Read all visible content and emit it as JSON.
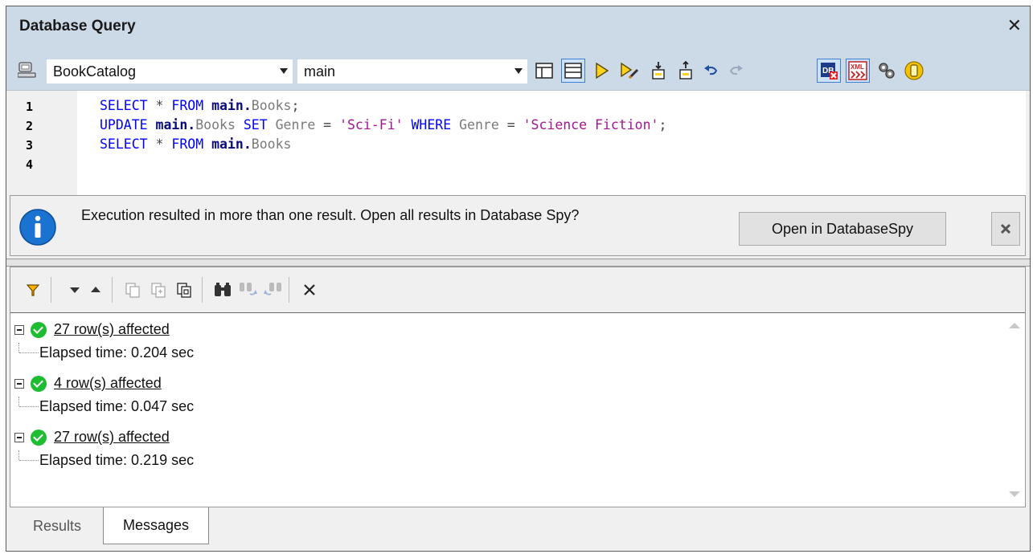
{
  "window": {
    "title": "Database Query"
  },
  "toolbar": {
    "datasource": "BookCatalog",
    "schema": "main",
    "icons": [
      "query-datasource-icon",
      "editor-layout-icon",
      "split-layout-icon",
      "execute-icon",
      "execute-for-editing-icon",
      "import-icon",
      "export-icon",
      "undo-icon",
      "redo-icon",
      "database-spy-icon",
      "xml-view-icon",
      "properties-icon",
      "options-icon"
    ]
  },
  "editor": {
    "line_numbers": [
      "1",
      "2",
      "3",
      "4"
    ],
    "lines": [
      [
        {
          "t": "SELECT",
          "c": "kw"
        },
        {
          "t": " * ",
          "c": "op"
        },
        {
          "t": "FROM",
          "c": "kw"
        },
        {
          "t": " ",
          "c": "op"
        },
        {
          "t": "main.",
          "c": "obj"
        },
        {
          "t": "Books",
          "c": "col"
        },
        {
          "t": ";",
          "c": "op"
        }
      ],
      [
        {
          "t": "UPDATE",
          "c": "kw"
        },
        {
          "t": " ",
          "c": "op"
        },
        {
          "t": "main.",
          "c": "obj"
        },
        {
          "t": "Books",
          "c": "col"
        },
        {
          "t": " ",
          "c": "op"
        },
        {
          "t": "SET",
          "c": "kw"
        },
        {
          "t": " ",
          "c": "op"
        },
        {
          "t": "Genre",
          "c": "col"
        },
        {
          "t": " = ",
          "c": "op"
        },
        {
          "t": "'Sci-Fi'",
          "c": "str"
        },
        {
          "t": " ",
          "c": "op"
        },
        {
          "t": "WHERE",
          "c": "kw"
        },
        {
          "t": " ",
          "c": "op"
        },
        {
          "t": "Genre",
          "c": "col"
        },
        {
          "t": " = ",
          "c": "op"
        },
        {
          "t": "'Science Fiction'",
          "c": "str"
        },
        {
          "t": ";",
          "c": "op"
        }
      ],
      [
        {
          "t": "SELECT",
          "c": "kw"
        },
        {
          "t": " * ",
          "c": "op"
        },
        {
          "t": "FROM",
          "c": "kw"
        },
        {
          "t": " ",
          "c": "op"
        },
        {
          "t": "main.",
          "c": "obj"
        },
        {
          "t": "Books",
          "c": "col"
        }
      ],
      []
    ]
  },
  "info": {
    "message": "Execution resulted in more than one result. Open all results in Database Spy?",
    "open_button": "Open in DatabaseSpy"
  },
  "messages": {
    "toolbar_icons": [
      "filter-icon",
      "next-message-icon",
      "previous-message-icon",
      "copy-icon",
      "copy-with-children-icon",
      "copy-all-icon",
      "find-icon",
      "find-next-icon",
      "find-previous-icon",
      "clear-icon"
    ],
    "items": [
      {
        "summary": "27 row(s) affected",
        "detail": "Elapsed time: 0.204 sec"
      },
      {
        "summary": "4 row(s) affected",
        "detail": "Elapsed time: 0.047 sec"
      },
      {
        "summary": "27 row(s) affected",
        "detail": "Elapsed time: 0.219 sec"
      }
    ]
  },
  "tabs": [
    {
      "label": "Results",
      "active": false
    },
    {
      "label": "Messages",
      "active": true
    }
  ]
}
